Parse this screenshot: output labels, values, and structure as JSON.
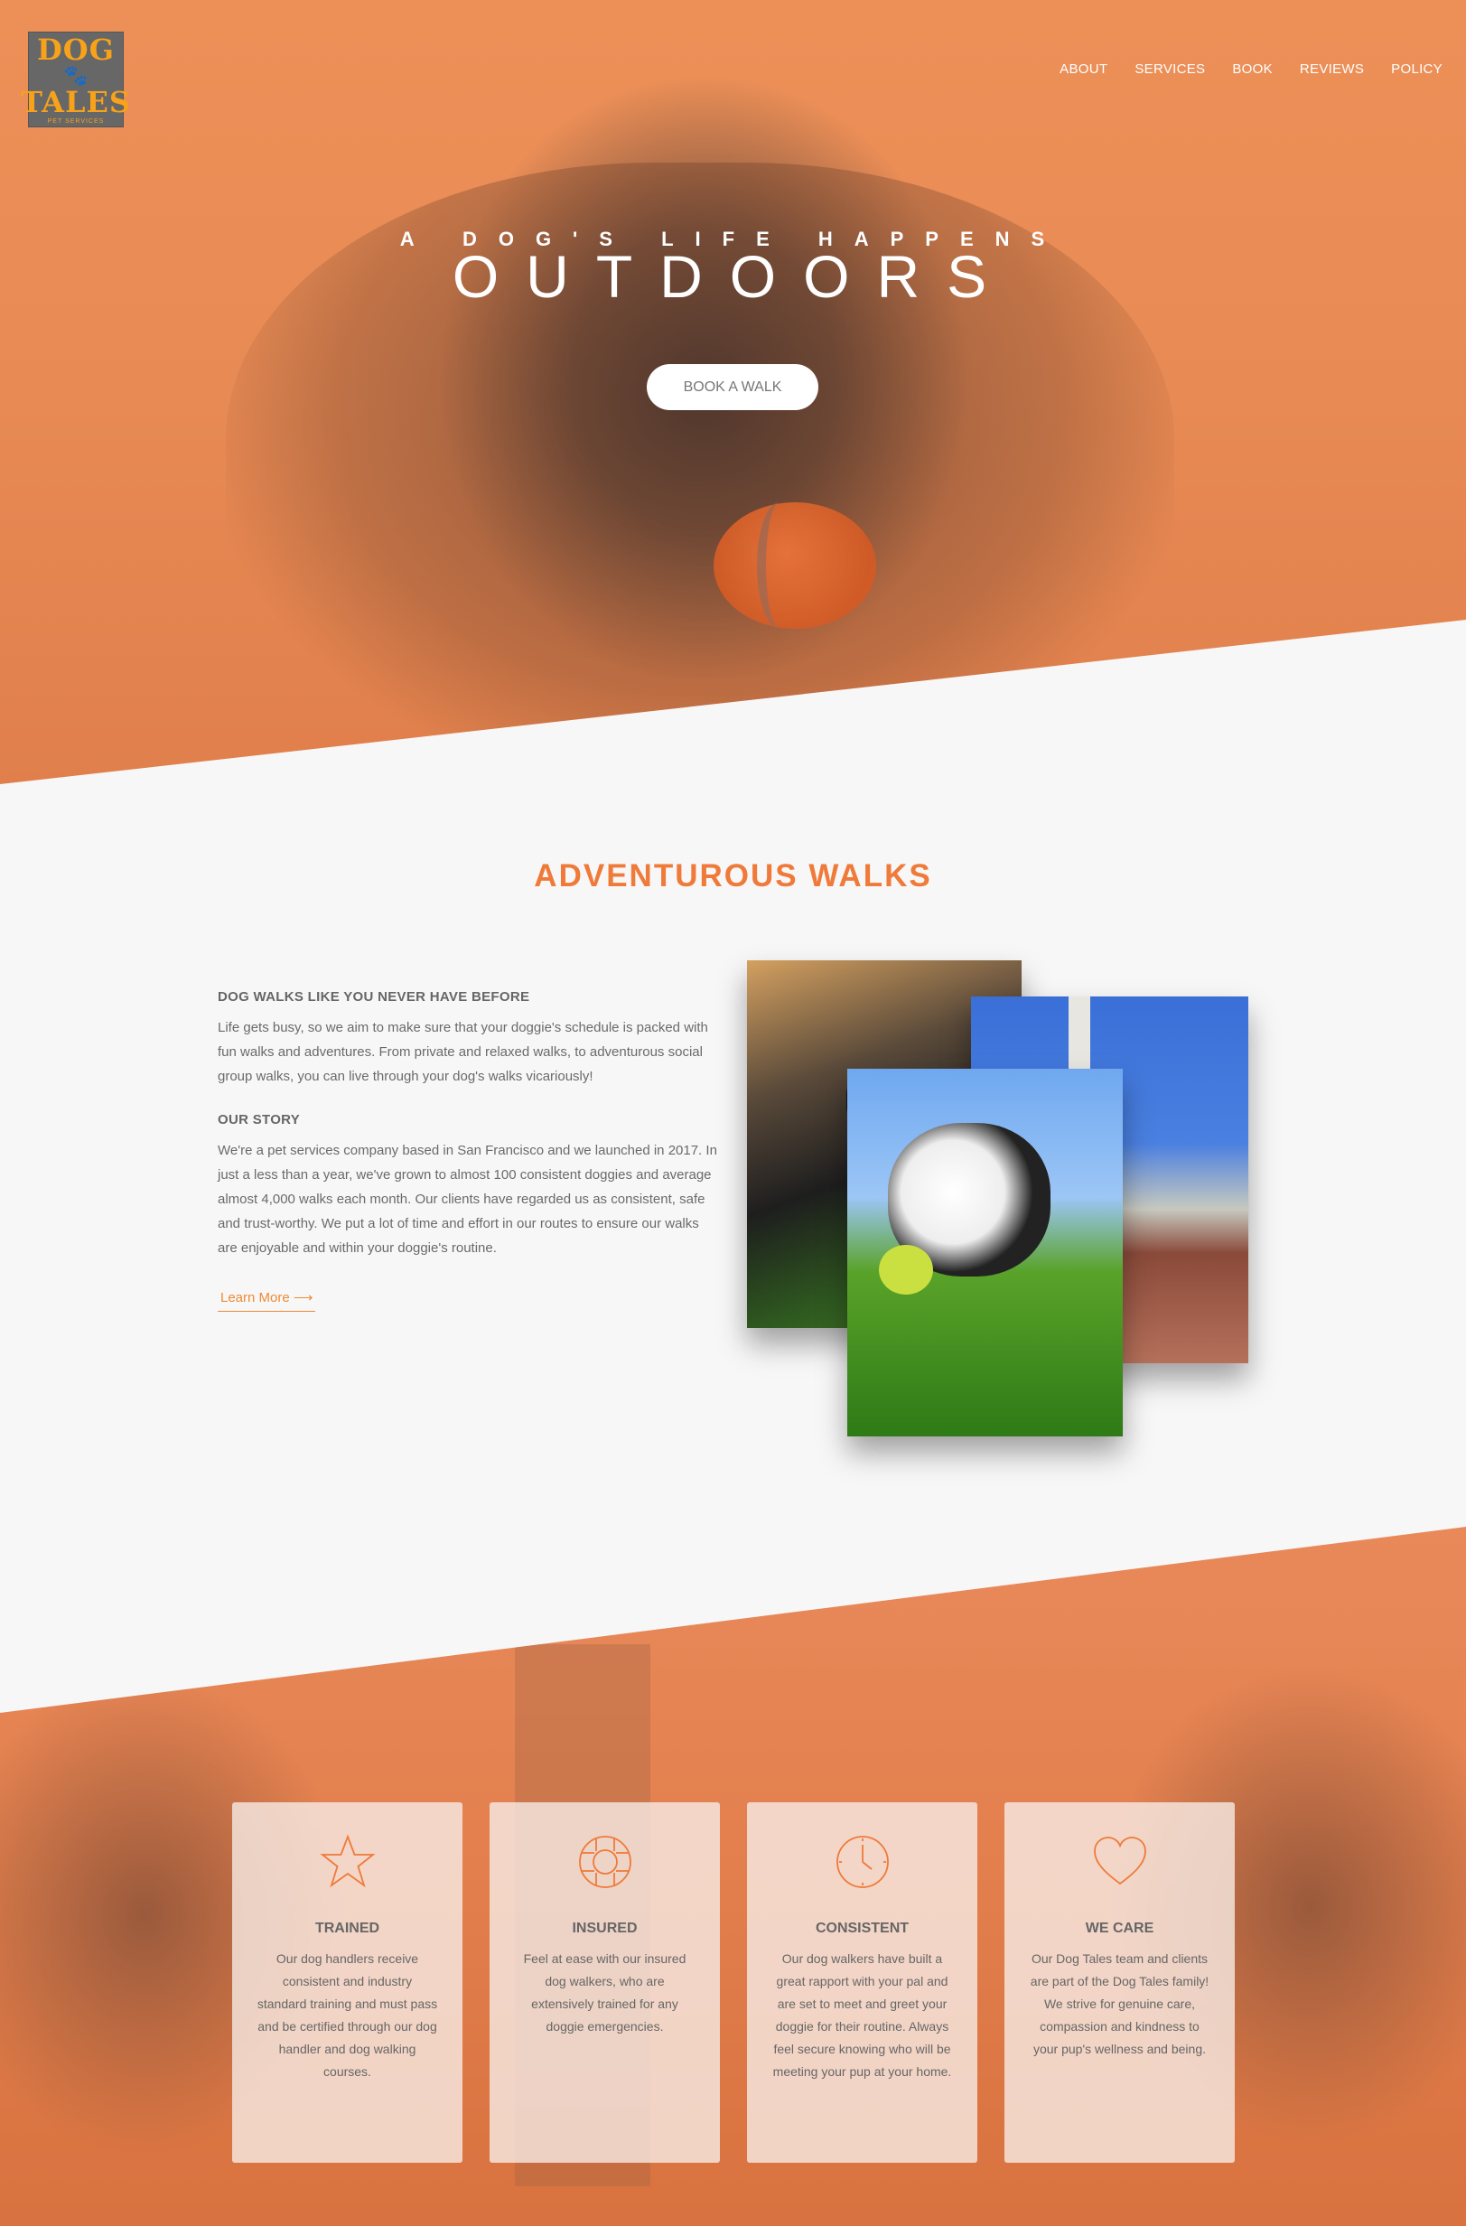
{
  "brand": {
    "logo_line1": "DOG",
    "logo_line2": "TALES",
    "logo_sub": "PET SERVICES",
    "accent_color": "#ef7a3a"
  },
  "nav": {
    "items": [
      {
        "label": "ABOUT"
      },
      {
        "label": "SERVICES"
      },
      {
        "label": "BOOK"
      },
      {
        "label": "REVIEWS"
      },
      {
        "label": "POLICY"
      }
    ]
  },
  "hero": {
    "tagline": "A DOG'S LIFE HAPPENS",
    "headline": "OUTDOORS",
    "cta_label": "BOOK A WALK"
  },
  "about": {
    "title": "ADVENTUROUS WALKS",
    "heading1": "DOG WALKS LIKE YOU NEVER HAVE BEFORE",
    "text1": "Life gets busy, so we aim to make sure that your doggie's schedule is packed with fun walks and adventures. From private and relaxed walks, to adventurous social group walks, you can live through your dog's walks vicariously!",
    "heading2": "OUR STORY",
    "text2": "We're a pet services company based in San Francisco and we launched in 2017. In just a less than a year, we've grown to almost 100 consistent doggies and average almost 4,000 walks each month. Our clients have regarded us as consistent, safe and trust-worthy. We put a lot of time and effort in our routes to ensure our walks are enjoyable and within your doggie's routine.",
    "learn_more": "Learn More ⟶"
  },
  "features": [
    {
      "icon": "star-icon",
      "title": "TRAINED",
      "text": "Our dog handlers receive consistent and industry standard training and must pass and be certified through our dog handler and dog walking courses."
    },
    {
      "icon": "lifebuoy-icon",
      "title": "INSURED",
      "text": "Feel at ease with our insured dog walkers, who are extensively trained for any doggie emergencies."
    },
    {
      "icon": "clock-icon",
      "title": "CONSISTENT",
      "text": "Our dog walkers have built a great rapport with your pal and are set to meet and greet your doggie for their routine. Always feel secure knowing who will be meeting your pup at your home."
    },
    {
      "icon": "heart-icon",
      "title": "WE CARE",
      "text": "Our Dog Tales team and clients are part of the Dog Tales family! We strive for genuine care, compassion and kindness to your pup's wellness and being."
    }
  ]
}
